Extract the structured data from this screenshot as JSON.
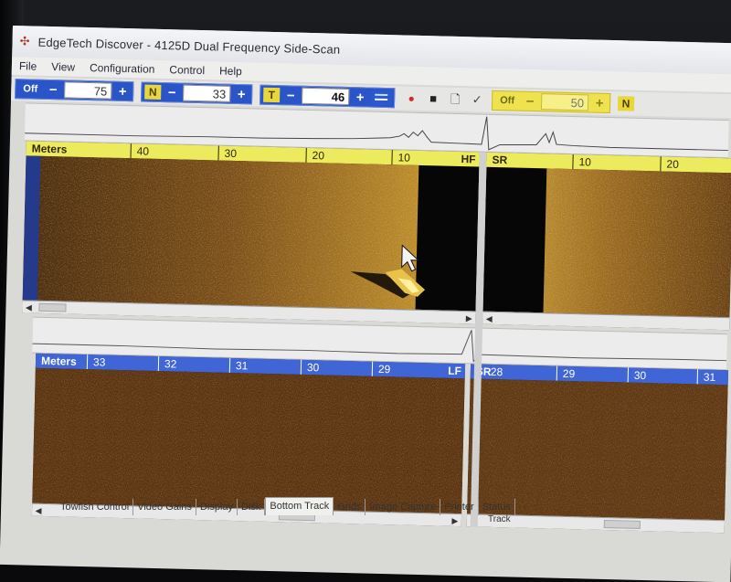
{
  "window": {
    "title": "EdgeTech Discover - 4125D  Dual Frequency Side-Scan",
    "app_icon": "edgetech-logo-icon"
  },
  "menu": [
    "File",
    "View",
    "Configuration",
    "Control",
    "Help"
  ],
  "toolbar": {
    "off_label": "Off",
    "minus": "−",
    "plus": "+",
    "range_value": "75",
    "n_letter": "N",
    "n_value": "33",
    "t_letter": "T",
    "t_value": "46",
    "off2_label": "Off",
    "right_value": "50",
    "n2_letter": "N"
  },
  "hf_panel": {
    "units_label": "Meters",
    "ticks": [
      "40",
      "30",
      "20",
      "10"
    ],
    "channel_tag": "HF",
    "sr_label": "SR",
    "sr_ticks": [
      "10",
      "20"
    ]
  },
  "lf_panel": {
    "units_label": "Meters",
    "ticks": [
      "33",
      "32",
      "31",
      "30",
      "29"
    ],
    "channel_tag": "LF",
    "sr_label": "SR",
    "sr_ticks": [
      "28",
      "29",
      "30",
      "31"
    ]
  },
  "tabs": [
    "Towfish Control",
    "Video Gains",
    "Display",
    "Disk",
    "Bottom Track",
    "Grids",
    "Image Capture",
    "Printer",
    "Status"
  ],
  "active_tab": "Bottom Track",
  "groupbox_label": "Track",
  "colors": {
    "hf_header": "#ecea5d",
    "lf_header": "#3f65d6",
    "toolbar_blue": "#2a55c8",
    "sonar_gold": "#c28a2a"
  }
}
